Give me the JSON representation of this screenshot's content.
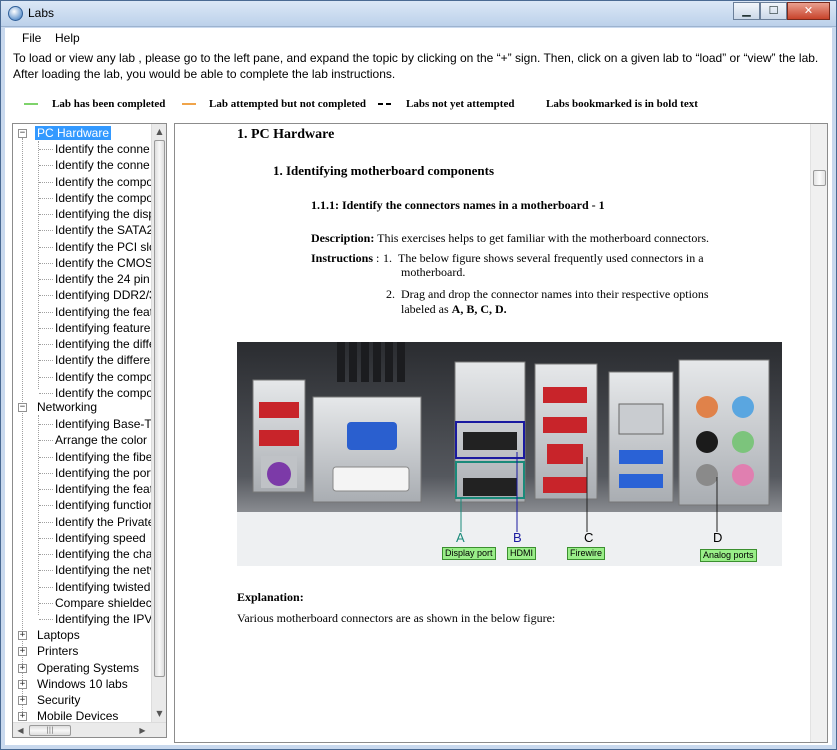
{
  "window": {
    "title": "Labs",
    "controls": {
      "minimize": "▁",
      "maximize": "☐",
      "close": "✕"
    }
  },
  "menu": [
    "File",
    "Help"
  ],
  "instructions": {
    "line1": "To load or view any lab , please go to the left pane, and expand the topic by clicking on the “+” sign. Then, click on a given lab to “load” or “view” the lab.",
    "line2": "After loading the lab, you would be able to complete the lab instructions."
  },
  "legend": {
    "completed": "Lab has been completed",
    "attempted": "Lab attempted but not completed",
    "not_attempted": "Labs not yet  attempted",
    "bookmarked": "Labs bookmarked is in bold text",
    "colors": {
      "completed": "#7ed36b",
      "attempted": "#f0a44a",
      "not_attempted": "#000000"
    }
  },
  "tree": {
    "pc_hardware": {
      "label": "PC Hardware",
      "items": [
        "Identify the conne",
        "Identify the conne",
        "Identify the compo",
        "Identify the compo",
        "Identifying the disp",
        "Identify the SATA2",
        "Identify the PCI slc",
        "Identify the CMOS",
        "Identify the 24 pin ,",
        "Identifying DDR2/3",
        "Identifying the feat",
        "Identifying features",
        "Identifying the diffe",
        "Identify the differer",
        "Identify the compo",
        "Identify the compo"
      ]
    },
    "networking": {
      "label": "Networking",
      "items": [
        "Identifying Base-T",
        "Arrange the color",
        "Identifying the fibe",
        "Identifying the port",
        "Identifying the feat",
        "Identifying functior",
        "Identify the Private",
        "Identifying speed",
        "Identifying the cha",
        "Identifying the netv",
        "Identifying twisted",
        "Compare shieldec",
        "Identifying the IPV"
      ]
    },
    "collapsed": [
      "Laptops",
      "Printers",
      "Operating Systems",
      "Windows 10 labs",
      "Security",
      "Mobile Devices"
    ],
    "hscroll_thumb": "|||"
  },
  "content": {
    "h1": "1. PC Hardware",
    "h2": "1. Identifying motherboard components",
    "h3": "1.1.1: Identify the connectors names in a motherboard - 1",
    "description_label": "Description:",
    "description_text": " This exercises helps to get familiar with the motherboard connectors.",
    "instructions_label": "Instructions",
    "instructions_sep": " : ",
    "step1_num": "1. ",
    "step1_a": "The  below figure shows several frequently used connectors in a",
    "step1_b": "motherboard.",
    "step2_num": "2. ",
    "step2_a": "Drag and drop the connector names into their respective options",
    "step2_b_prefix": "labeled as ",
    "step2_b_bold": "A, B, C, D.",
    "figure": {
      "letters": [
        "A",
        "B",
        "C",
        "D"
      ],
      "tags": [
        "Display port",
        "HDMI",
        "Firewire",
        "Analog ports"
      ],
      "letter_colors": [
        "#1a8a7a",
        "#1a1aa0",
        "#000000",
        "#000000"
      ]
    },
    "explanation_head": "Explanation:",
    "explanation_text": "Various motherboard connectors are as shown in the below figure:"
  }
}
